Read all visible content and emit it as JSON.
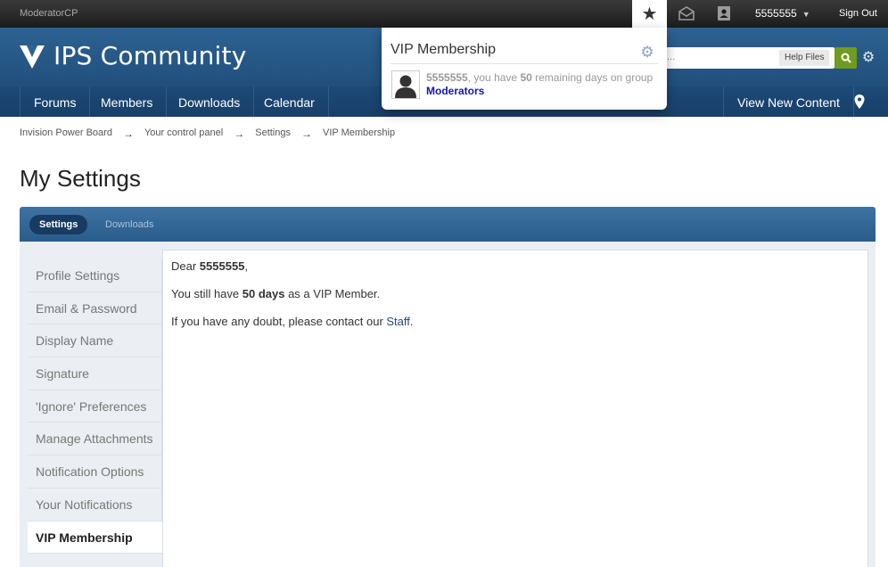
{
  "userbar": {
    "modcp_label": "ModeratorCP",
    "username": "5555555",
    "sign_out": "Sign Out",
    "icons": [
      "star-icon",
      "envelope-icon",
      "contact-card-icon",
      "chevron-down-icon"
    ]
  },
  "branding": {
    "logo_text": "IPS Community",
    "search_placeholder_visible": "...",
    "help_files": "Help Files"
  },
  "nav": {
    "items": [
      "Forums",
      "Members",
      "Downloads",
      "Calendar"
    ],
    "view_new_content": "View New Content"
  },
  "breadcrumb": [
    "Invision Power Board",
    "Your control panel",
    "Settings",
    "VIP Membership"
  ],
  "breadcrumb_separator": "→",
  "page_title": "My Settings",
  "tabs": {
    "settings": "Settings",
    "downloads": "Downloads"
  },
  "side_menu": [
    "Profile Settings",
    "Email & Password",
    "Display Name",
    "Signature",
    "'Ignore' Preferences",
    "Manage Attachments",
    "Notification Options",
    "Your Notifications",
    "VIP Membership"
  ],
  "main": {
    "dear_prefix": "Dear ",
    "dear_name": "5555555",
    "dear_suffix": ",",
    "line2_prefix": "You still have ",
    "line2_days": "50 days",
    "line2_suffix": " as a VIP Member.",
    "line3_prefix": "If you have any doubt, please contact our ",
    "line3_link": "Staff",
    "line3_suffix": "."
  },
  "popup": {
    "title": "VIP Membership",
    "msg_name": "5555555",
    "msg_mid": ", you have ",
    "msg_days": "50",
    "msg_end": " remaining days on group",
    "group": "Moderators"
  },
  "colors": {
    "brand_blue": "#2d6292",
    "nav_blue": "#1d4a78",
    "search_green": "#6f9b20",
    "link_blue": "#1d4a86",
    "group_link": "#1515b0"
  }
}
